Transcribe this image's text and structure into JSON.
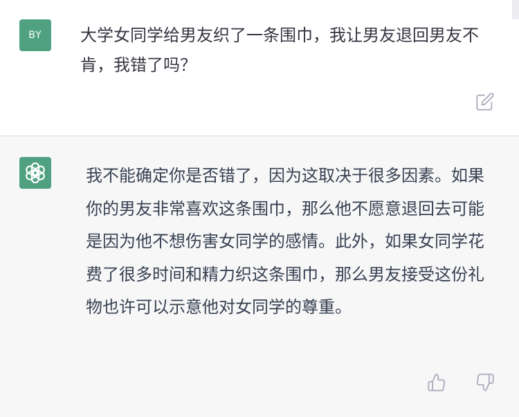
{
  "user_message": {
    "avatar_initials": "BY",
    "text": "大学女同学给男友织了一条围巾，我让男友退回男友不肯，我错了吗？"
  },
  "assistant_message": {
    "avatar_icon": "openai-logo-icon",
    "text": "我不能确定你是否错了，因为这取决于很多因素。如果你的男友非常喜欢这条围巾，那么他不愿意退回去可能是因为他不想伤害女同学的感情。此外，如果女同学花费了很多时间和精力织这条围巾，那么男友接受这份礼物也许可以示意他对女同学的尊重。"
  },
  "actions": {
    "edit_icon": "edit-icon",
    "thumbs_up_icon": "thumbs-up-icon",
    "thumbs_down_icon": "thumbs-down-icon"
  },
  "colors": {
    "avatar_green": "#4fa182",
    "assistant_bg": "#f7f7f8",
    "text": "#343541",
    "icon": "#acacbe"
  }
}
